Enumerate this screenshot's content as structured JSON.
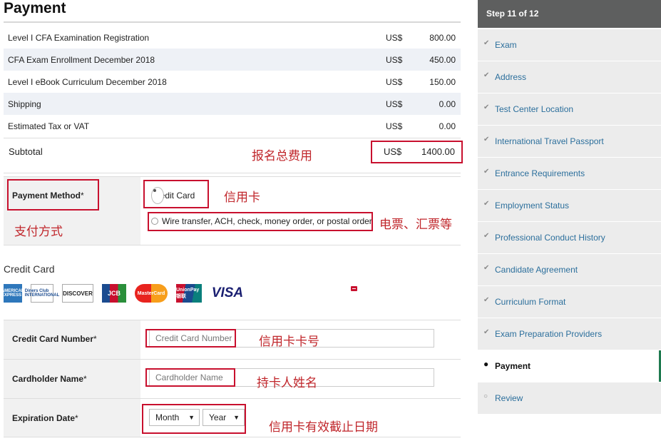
{
  "page": {
    "title": "Payment"
  },
  "line_items": [
    {
      "label": "Level I CFA Examination Registration",
      "currency": "US$",
      "amount": "800.00"
    },
    {
      "label": "CFA Exam Enrollment December 2018",
      "currency": "US$",
      "amount": "450.00"
    },
    {
      "label": "Level I eBook Curriculum December 2018",
      "currency": "US$",
      "amount": "150.00"
    },
    {
      "label": "Shipping",
      "currency": "US$",
      "amount": "0.00"
    },
    {
      "label": "Estimated Tax or VAT",
      "currency": "US$",
      "amount": "0.00"
    }
  ],
  "subtotal": {
    "label": "Subtotal",
    "currency": "US$",
    "amount": "1400.00"
  },
  "payment_method": {
    "label": "Payment Method",
    "required_mark": "*",
    "options": [
      {
        "label": "Credit Card",
        "selected": true
      },
      {
        "label": "Wire transfer, ACH, check, money order, or postal order",
        "selected": false
      }
    ]
  },
  "credit_card": {
    "heading": "Credit Card",
    "logos": [
      "AMERICAN EXPRESS",
      "Diners Club INTERNATIONAL",
      "DISCOVER",
      "JCB",
      "MasterCard",
      "UnionPay 银联",
      "VISA"
    ],
    "number": {
      "label": "Credit Card Number",
      "required_mark": "*",
      "placeholder": "Credit Card Number"
    },
    "holder": {
      "label": "Cardholder Name",
      "required_mark": "*",
      "placeholder": "Cardholder Name"
    },
    "expiry": {
      "label": "Expiration Date",
      "required_mark": "*",
      "month": "Month",
      "year": "Year"
    }
  },
  "annotations": {
    "total_fee": "报名总费用",
    "payment_method": "支付方式",
    "credit_card": "信用卡",
    "wire": "电票、汇票等",
    "card_number": "信用卡卡号",
    "holder_name": "持卡人姓名",
    "expiry": "信用卡有效截止日期"
  },
  "sidebar": {
    "step": "Step 11 of 12",
    "items": [
      {
        "label": "Exam",
        "status": "done"
      },
      {
        "label": "Address",
        "status": "done"
      },
      {
        "label": "Test Center Location",
        "status": "done"
      },
      {
        "label": "International Travel Passport",
        "status": "done"
      },
      {
        "label": "Entrance Requirements",
        "status": "done"
      },
      {
        "label": "Employment Status",
        "status": "done"
      },
      {
        "label": "Professional Conduct History",
        "status": "done"
      },
      {
        "label": "Candidate Agreement",
        "status": "done"
      },
      {
        "label": "Curriculum Format",
        "status": "done"
      },
      {
        "label": "Exam Preparation Providers",
        "status": "done"
      },
      {
        "label": "Payment",
        "status": "current"
      },
      {
        "label": "Review",
        "status": "pending"
      }
    ]
  },
  "colors": {
    "accent_red": "#c8102e",
    "sidebar_header": "#5e5f5f",
    "link_blue": "#2c6f9c",
    "active_green": "#1e7a4f"
  }
}
